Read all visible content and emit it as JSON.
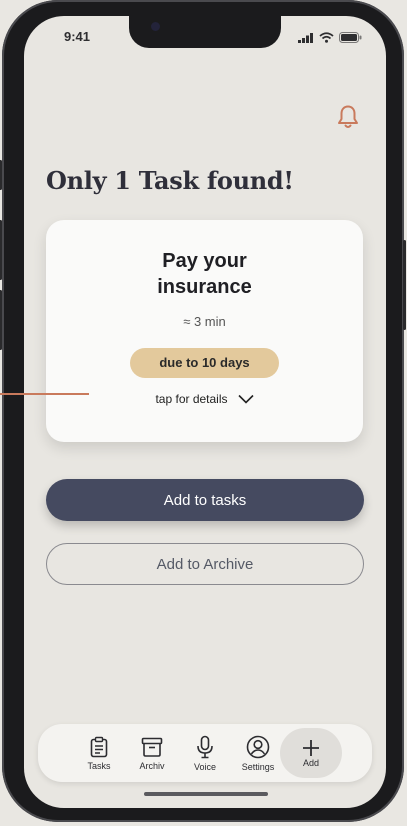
{
  "status_bar": {
    "time": "9:41"
  },
  "page": {
    "title": "Only 1 Task found!"
  },
  "task_card": {
    "title_line1": "Pay your",
    "title_line2": "insurance",
    "duration": "≈ 3 min",
    "due": "due to 10 days",
    "details_label": "tap for details"
  },
  "actions": {
    "add_to_tasks": "Add to tasks",
    "add_to_archive": "Add to Archive"
  },
  "tabbar": {
    "items": [
      {
        "label": "Tasks",
        "icon": "clipboard-icon"
      },
      {
        "label": "Archiv",
        "icon": "archive-box-icon"
      },
      {
        "label": "Voice",
        "icon": "microphone-icon"
      },
      {
        "label": "Settings",
        "icon": "user-circle-icon"
      },
      {
        "label": "Add",
        "icon": "plus-icon"
      }
    ]
  },
  "colors": {
    "primary_button": "#454a60",
    "badge": "#e3c99c",
    "accent": "#c97a5c"
  }
}
